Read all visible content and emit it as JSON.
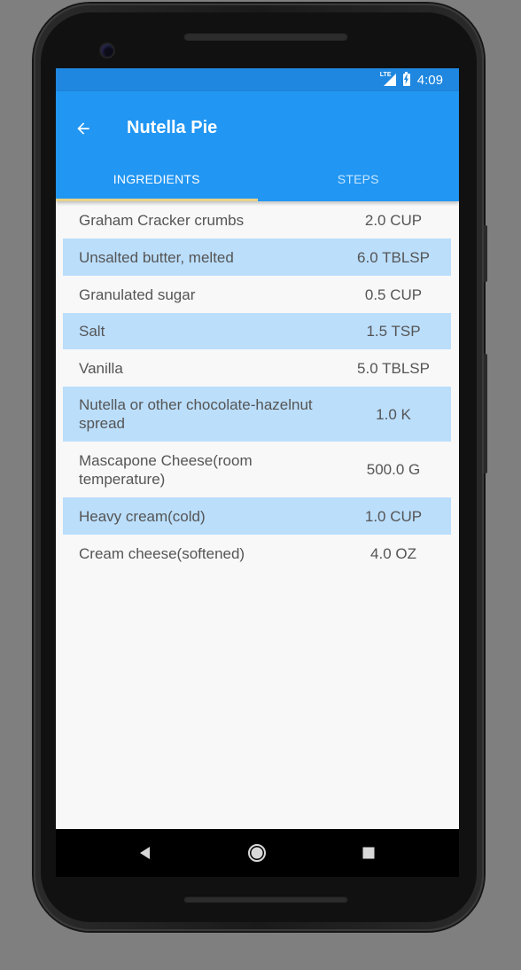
{
  "status_bar": {
    "network": "LTE",
    "time": "4:09"
  },
  "app_bar": {
    "title": "Nutella Pie",
    "back_icon": "arrow-back-icon",
    "color": "#2196f3"
  },
  "tabs": [
    {
      "label": "INGREDIENTS",
      "selected": true
    },
    {
      "label": "STEPS",
      "selected": false
    }
  ],
  "ingredients": [
    {
      "name": "Graham Cracker crumbs",
      "quantity": "2.0 CUP"
    },
    {
      "name": "Unsalted butter, melted",
      "quantity": "6.0 TBLSP"
    },
    {
      "name": "Granulated sugar",
      "quantity": "0.5 CUP"
    },
    {
      "name": "Salt",
      "quantity": "1.5 TSP"
    },
    {
      "name": "Vanilla",
      "quantity": "5.0 TBLSP"
    },
    {
      "name": "Nutella or other chocolate-hazelnut spread",
      "quantity": "1.0 K"
    },
    {
      "name": "Mascapone Cheese(room temperature)",
      "quantity": "500.0 G"
    },
    {
      "name": "Heavy cream(cold)",
      "quantity": "1.0 CUP"
    },
    {
      "name": "Cream cheese(softened)",
      "quantity": "4.0 OZ"
    }
  ],
  "nav_bar": {
    "back_icon": "nav-back-icon",
    "home_icon": "nav-home-icon",
    "recents_icon": "nav-recents-icon"
  },
  "colors": {
    "status_bar": "#1f87df",
    "alt_row": "#bbdefb",
    "tab_indicator": "#e8d388"
  }
}
